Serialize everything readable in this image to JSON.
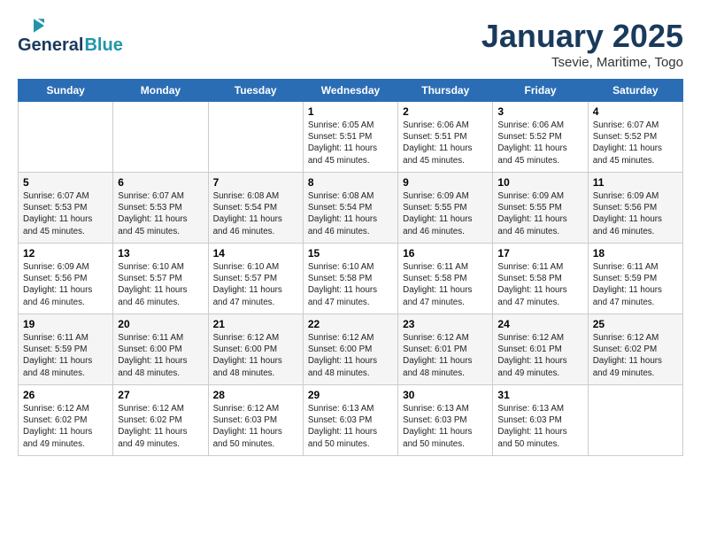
{
  "header": {
    "logo_line1": "General",
    "logo_line2": "Blue",
    "month_title": "January 2025",
    "subtitle": "Tsevie, Maritime, Togo"
  },
  "weekdays": [
    "Sunday",
    "Monday",
    "Tuesday",
    "Wednesday",
    "Thursday",
    "Friday",
    "Saturday"
  ],
  "weeks": [
    [
      {
        "day": "",
        "info": ""
      },
      {
        "day": "",
        "info": ""
      },
      {
        "day": "",
        "info": ""
      },
      {
        "day": "1",
        "info": "Sunrise: 6:05 AM\nSunset: 5:51 PM\nDaylight: 11 hours and 45 minutes."
      },
      {
        "day": "2",
        "info": "Sunrise: 6:06 AM\nSunset: 5:51 PM\nDaylight: 11 hours and 45 minutes."
      },
      {
        "day": "3",
        "info": "Sunrise: 6:06 AM\nSunset: 5:52 PM\nDaylight: 11 hours and 45 minutes."
      },
      {
        "day": "4",
        "info": "Sunrise: 6:07 AM\nSunset: 5:52 PM\nDaylight: 11 hours and 45 minutes."
      }
    ],
    [
      {
        "day": "5",
        "info": "Sunrise: 6:07 AM\nSunset: 5:53 PM\nDaylight: 11 hours and 45 minutes."
      },
      {
        "day": "6",
        "info": "Sunrise: 6:07 AM\nSunset: 5:53 PM\nDaylight: 11 hours and 45 minutes."
      },
      {
        "day": "7",
        "info": "Sunrise: 6:08 AM\nSunset: 5:54 PM\nDaylight: 11 hours and 46 minutes."
      },
      {
        "day": "8",
        "info": "Sunrise: 6:08 AM\nSunset: 5:54 PM\nDaylight: 11 hours and 46 minutes."
      },
      {
        "day": "9",
        "info": "Sunrise: 6:09 AM\nSunset: 5:55 PM\nDaylight: 11 hours and 46 minutes."
      },
      {
        "day": "10",
        "info": "Sunrise: 6:09 AM\nSunset: 5:55 PM\nDaylight: 11 hours and 46 minutes."
      },
      {
        "day": "11",
        "info": "Sunrise: 6:09 AM\nSunset: 5:56 PM\nDaylight: 11 hours and 46 minutes."
      }
    ],
    [
      {
        "day": "12",
        "info": "Sunrise: 6:09 AM\nSunset: 5:56 PM\nDaylight: 11 hours and 46 minutes."
      },
      {
        "day": "13",
        "info": "Sunrise: 6:10 AM\nSunset: 5:57 PM\nDaylight: 11 hours and 46 minutes."
      },
      {
        "day": "14",
        "info": "Sunrise: 6:10 AM\nSunset: 5:57 PM\nDaylight: 11 hours and 47 minutes."
      },
      {
        "day": "15",
        "info": "Sunrise: 6:10 AM\nSunset: 5:58 PM\nDaylight: 11 hours and 47 minutes."
      },
      {
        "day": "16",
        "info": "Sunrise: 6:11 AM\nSunset: 5:58 PM\nDaylight: 11 hours and 47 minutes."
      },
      {
        "day": "17",
        "info": "Sunrise: 6:11 AM\nSunset: 5:58 PM\nDaylight: 11 hours and 47 minutes."
      },
      {
        "day": "18",
        "info": "Sunrise: 6:11 AM\nSunset: 5:59 PM\nDaylight: 11 hours and 47 minutes."
      }
    ],
    [
      {
        "day": "19",
        "info": "Sunrise: 6:11 AM\nSunset: 5:59 PM\nDaylight: 11 hours and 48 minutes."
      },
      {
        "day": "20",
        "info": "Sunrise: 6:11 AM\nSunset: 6:00 PM\nDaylight: 11 hours and 48 minutes."
      },
      {
        "day": "21",
        "info": "Sunrise: 6:12 AM\nSunset: 6:00 PM\nDaylight: 11 hours and 48 minutes."
      },
      {
        "day": "22",
        "info": "Sunrise: 6:12 AM\nSunset: 6:00 PM\nDaylight: 11 hours and 48 minutes."
      },
      {
        "day": "23",
        "info": "Sunrise: 6:12 AM\nSunset: 6:01 PM\nDaylight: 11 hours and 48 minutes."
      },
      {
        "day": "24",
        "info": "Sunrise: 6:12 AM\nSunset: 6:01 PM\nDaylight: 11 hours and 49 minutes."
      },
      {
        "day": "25",
        "info": "Sunrise: 6:12 AM\nSunset: 6:02 PM\nDaylight: 11 hours and 49 minutes."
      }
    ],
    [
      {
        "day": "26",
        "info": "Sunrise: 6:12 AM\nSunset: 6:02 PM\nDaylight: 11 hours and 49 minutes."
      },
      {
        "day": "27",
        "info": "Sunrise: 6:12 AM\nSunset: 6:02 PM\nDaylight: 11 hours and 49 minutes."
      },
      {
        "day": "28",
        "info": "Sunrise: 6:12 AM\nSunset: 6:03 PM\nDaylight: 11 hours and 50 minutes."
      },
      {
        "day": "29",
        "info": "Sunrise: 6:13 AM\nSunset: 6:03 PM\nDaylight: 11 hours and 50 minutes."
      },
      {
        "day": "30",
        "info": "Sunrise: 6:13 AM\nSunset: 6:03 PM\nDaylight: 11 hours and 50 minutes."
      },
      {
        "day": "31",
        "info": "Sunrise: 6:13 AM\nSunset: 6:03 PM\nDaylight: 11 hours and 50 minutes."
      },
      {
        "day": "",
        "info": ""
      }
    ]
  ]
}
